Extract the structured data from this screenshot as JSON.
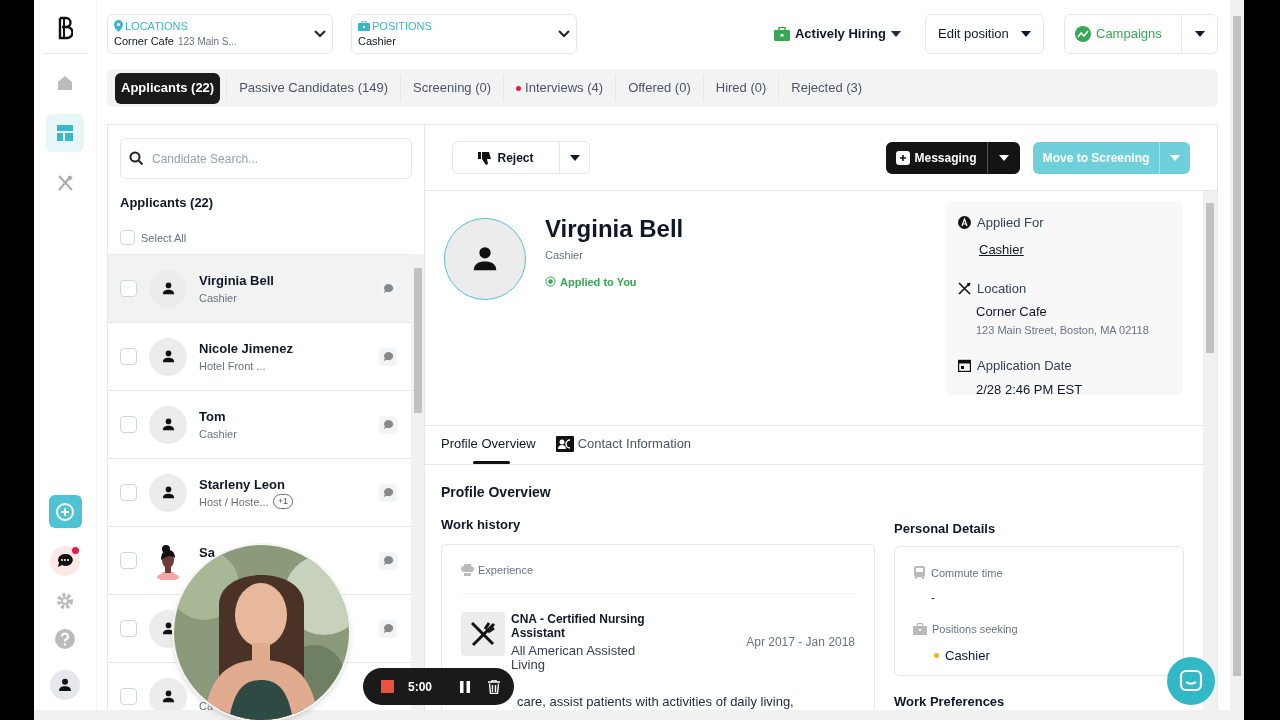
{
  "nav_top": [
    {
      "kind": "home",
      "selected": false
    },
    {
      "kind": "dashboard",
      "selected": true
    },
    {
      "kind": "utensils",
      "selected": false
    }
  ],
  "nav_bottom": [
    {
      "kind": "add",
      "notification": false
    },
    {
      "kind": "chat",
      "notification": true
    },
    {
      "kind": "settings",
      "notification": false
    },
    {
      "kind": "help",
      "notification": false
    },
    {
      "kind": "profile",
      "notification": false
    }
  ],
  "filters": [
    {
      "kind": "location",
      "label": "LOCATIONS",
      "value": "Corner Cafe",
      "detail": "123 Main S..."
    },
    {
      "kind": "position",
      "label": "POSITIONS",
      "value": "Cashier"
    }
  ],
  "header_actions": {
    "hiring_status": "Actively Hiring",
    "edit": "Edit position",
    "campaigns": "Campaigns"
  },
  "tabs": [
    {
      "label": "Applicants (22)",
      "selected": true,
      "alert": false
    },
    {
      "label": "Passive Candidates (149)",
      "selected": false,
      "alert": false
    },
    {
      "label": "Screening (0)",
      "selected": false,
      "alert": false
    },
    {
      "label": "Interviews (4)",
      "selected": false,
      "alert": true
    },
    {
      "label": "Offered (0)",
      "selected": false,
      "alert": false
    },
    {
      "label": "Hired (0)",
      "selected": false,
      "alert": false
    },
    {
      "label": "Rejected (3)",
      "selected": false,
      "alert": false
    }
  ],
  "candidate_list": {
    "search_placeholder": "Candidate Search...",
    "heading": "Applicants (22)",
    "select_all": {
      "label": "Select All",
      "checked": false
    },
    "rows": [
      {
        "name": "Virginia Bell",
        "subtitle": "Cashier",
        "selected": true,
        "checked": false,
        "kind": "default"
      },
      {
        "name": "Nicole Jimenez",
        "subtitle": "Hotel Front ...",
        "selected": false,
        "checked": false,
        "kind": "default"
      },
      {
        "name": "Tom",
        "subtitle": "Cashier",
        "selected": false,
        "checked": false,
        "kind": "default"
      },
      {
        "name": "Starleny Leon",
        "subtitle": "Host / Hoste...",
        "extra": "+1",
        "selected": false,
        "checked": false,
        "kind": "default"
      },
      {
        "name": "Sa",
        "selected": false,
        "checked": false,
        "kind": "illustration"
      },
      {
        "selected": false,
        "checked": false,
        "kind": "default"
      },
      {
        "subtitle": "Ca",
        "selected": false,
        "checked": false,
        "kind": "default"
      }
    ]
  },
  "toolbar": {
    "reject": "Reject",
    "messaging": "Messaging",
    "advance": {
      "label": "Move to Screening",
      "disabled": true
    }
  },
  "profile": {
    "name": "Virginia Bell",
    "position": "Cashier",
    "status": "Applied to You",
    "applied_for_label": "Applied For",
    "applied_for": "Cashier",
    "location_label": "Location",
    "location": "Corner Cafe",
    "address": "123 Main Street, Boston, MA 02118",
    "date_label": "Application Date",
    "date": "2/28 2:46 PM EST"
  },
  "detail_tabs": [
    {
      "kind": "overview",
      "label": "Profile Overview",
      "selected": true
    },
    {
      "kind": "contact",
      "label": "Contact Information",
      "selected": false
    }
  ],
  "overview": {
    "heading": "Profile Overview",
    "work_history": {
      "heading": "Work history",
      "section": "Experience",
      "jobs": [
        {
          "title": "CNA - Certified Nursing Assistant",
          "employer": "All American Assisted Living",
          "dates": "Apr 2017 - Jan 2018",
          "description": "care, assist patients with activities of daily living,"
        }
      ]
    },
    "personal_details": {
      "heading": "Personal Details",
      "commute_label": "Commute time",
      "commute": "-",
      "positions_label": "Positions seeking",
      "positions": [
        "Cashier"
      ]
    },
    "work_preferences": "Work Preferences"
  },
  "recorder": {
    "time": "5:00"
  }
}
